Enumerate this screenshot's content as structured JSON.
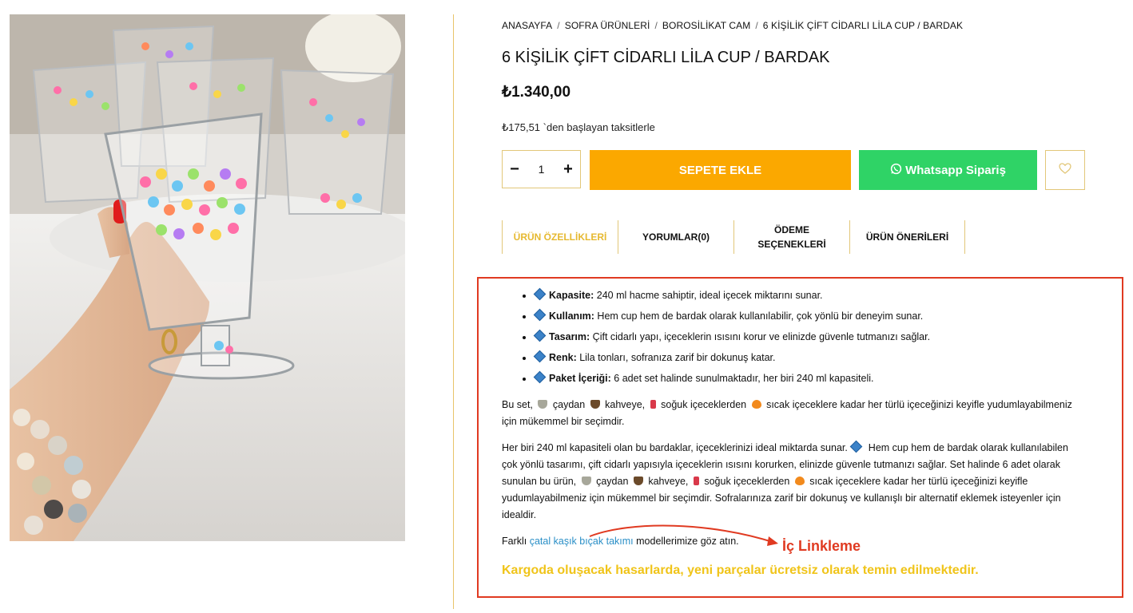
{
  "breadcrumb": [
    "ANASAYFA",
    "SOFRA ÜRÜNLERİ",
    "BOROSİLİKAT CAM",
    "6 KİŞİLİK ÇİFT CİDARLI LİLA CUP / BARDAK"
  ],
  "product": {
    "title": "6 KİŞİLİK ÇİFT CİDARLI LİLA CUP / BARDAK",
    "price": "₺1.340,00",
    "installments": "₺175,51 `den başlayan taksitlerle",
    "quantity": "1"
  },
  "buttons": {
    "minus": "−",
    "plus": "+",
    "add_to_cart": "SEPETE EKLE",
    "whatsapp": "Whatsapp Sipariş"
  },
  "tabs": [
    "ÜRÜN ÖZELLİKLERİ",
    "YORUMLAR(0)",
    "ÖDEME SEÇENEKLERİ",
    "ÜRÜN ÖNERİLERİ"
  ],
  "features": [
    {
      "label": "Kapasite:",
      "text": " 240 ml hacme sahiptir, ideal içecek miktarını sunar."
    },
    {
      "label": "Kullanım:",
      "text": " Hem cup hem de bardak olarak kullanılabilir, çok yönlü bir deneyim sunar."
    },
    {
      "label": "Tasarım:",
      "text": " Çift cidarlı yapı, içeceklerin ısısını korur ve elinizde güvenle tutmanızı sağlar."
    },
    {
      "label": "Renk:",
      "text": " Lila tonları, sofranıza zarif bir dokunuş katar."
    },
    {
      "label": "Paket İçeriği:",
      "text": " 6 adet set halinde sunulmaktadır, her biri 240 ml kapasiteli."
    }
  ],
  "paragraph1": {
    "a": "Bu set, ",
    "b": " çaydan ",
    "c": " kahveye, ",
    "d": " soğuk içeceklerden ",
    "e": " sıcak içeceklere kadar her türlü içeceğinizi keyifle yudumlayabilmeniz için mükemmel bir seçimdir."
  },
  "paragraph2": {
    "a": "Her biri 240 ml kapasiteli olan bu bardaklar, içeceklerinizi ideal miktarda sunar. ",
    "b": " Hem cup hem de bardak olarak kullanılabilen çok yönlü tasarımı, çift cidarlı yapısıyla içeceklerin ısısını korurken, elinizde güvenle tutmanızı sağlar. Set halinde 6 adet olarak sunulan bu ürün, ",
    "c": " çaydan ",
    "d": " kahveye, ",
    "e": " soğuk içeceklerden ",
    "f": " sıcak içeceklere kadar her türlü içeceğinizi keyifle yudumlayabilmeniz için mükemmel bir seçimdir. Sofralarınıza zarif bir dokunuş ve kullanışlı bir alternatif eklemek isteyenler için idealdir."
  },
  "paragraph3": {
    "before": "Farklı ",
    "link": "çatal kaşık bıçak takımı",
    "after": " modellerimize göz atın."
  },
  "shipping_note": "Kargoda oluşacak hasarlarda, yeni parçalar ücretsiz olarak temin edilmektedir.",
  "annotation": "İç Linkleme",
  "colors": {
    "accent_gold": "#e6b930",
    "cart_orange": "#fba800",
    "whatsapp_green": "#2fd366",
    "annotation_red": "#e03a21",
    "link_blue": "#2a8fc7"
  }
}
